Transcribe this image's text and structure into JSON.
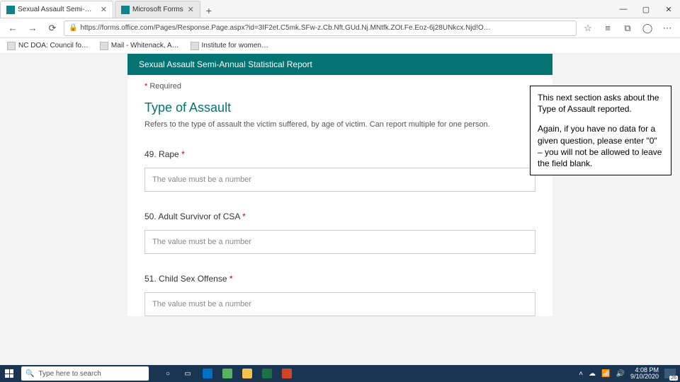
{
  "window": {
    "min": "—",
    "max": "▢",
    "close": "✕"
  },
  "tabs": [
    {
      "label": "Sexual Assault Semi-Annual Stati"
    },
    {
      "label": "Microsoft Forms"
    }
  ],
  "newtab": "+",
  "nav": {
    "back": "←",
    "fwd": "→",
    "reload": "⟳"
  },
  "addr": {
    "lock": "🔒",
    "url": "https://forms.office.com/Pages/Response.Page.aspx?id=3IF2et.C5mk.SFw-z.Cb.Nft.GUd.Nj.MNtfk.ZOt.Fe.Eoz-6j28UNkcx.Njd!O…"
  },
  "nav_icons": {
    "star": "☆",
    "fav": "≡",
    "ext": "⧉",
    "user": "◯",
    "more": "⋯"
  },
  "bookmarks": [
    "NC DOA: Council fo…",
    "Mail - Whitenack, A…",
    "Institute for women…"
  ],
  "form": {
    "header": "Sexual Assault Semi-Annual Statistical Report",
    "required": "Required",
    "ast": "*",
    "section_title": "Type of Assault",
    "section_desc": "Refers to the type of assault the victim suffered, by age of victim. Can report multiple for one person.",
    "questions": [
      {
        "num": "49.",
        "label": "Rape",
        "placeholder": "The value must be a number"
      },
      {
        "num": "50.",
        "label": "Adult Survivor of CSA",
        "placeholder": "The value must be a number"
      },
      {
        "num": "51.",
        "label": "Child Sex Offense",
        "placeholder": "The value must be a number"
      }
    ]
  },
  "callout": {
    "p1": "This next section asks about the Type of Assault reported.",
    "p2": "Again, if you have no data for a given question, please enter \"0\" – you will not be allowed to leave the field blank."
  },
  "taskbar": {
    "search_placeholder": "Type here to search",
    "search_icon": "🔍",
    "time": "4:08 PM",
    "date": "9/10/2020",
    "notif_count": "26",
    "tray": {
      "up": "˄",
      "cloud": "☁",
      "wifi": "📶",
      "sound": "🔊"
    },
    "apps": {
      "cortana": "○",
      "taskview": "▭",
      "outlook": "#0072c6",
      "edge": "#57b560",
      "files": "#f5c24d",
      "excel": "#1e7145",
      "ppt": "#d04525"
    }
  }
}
